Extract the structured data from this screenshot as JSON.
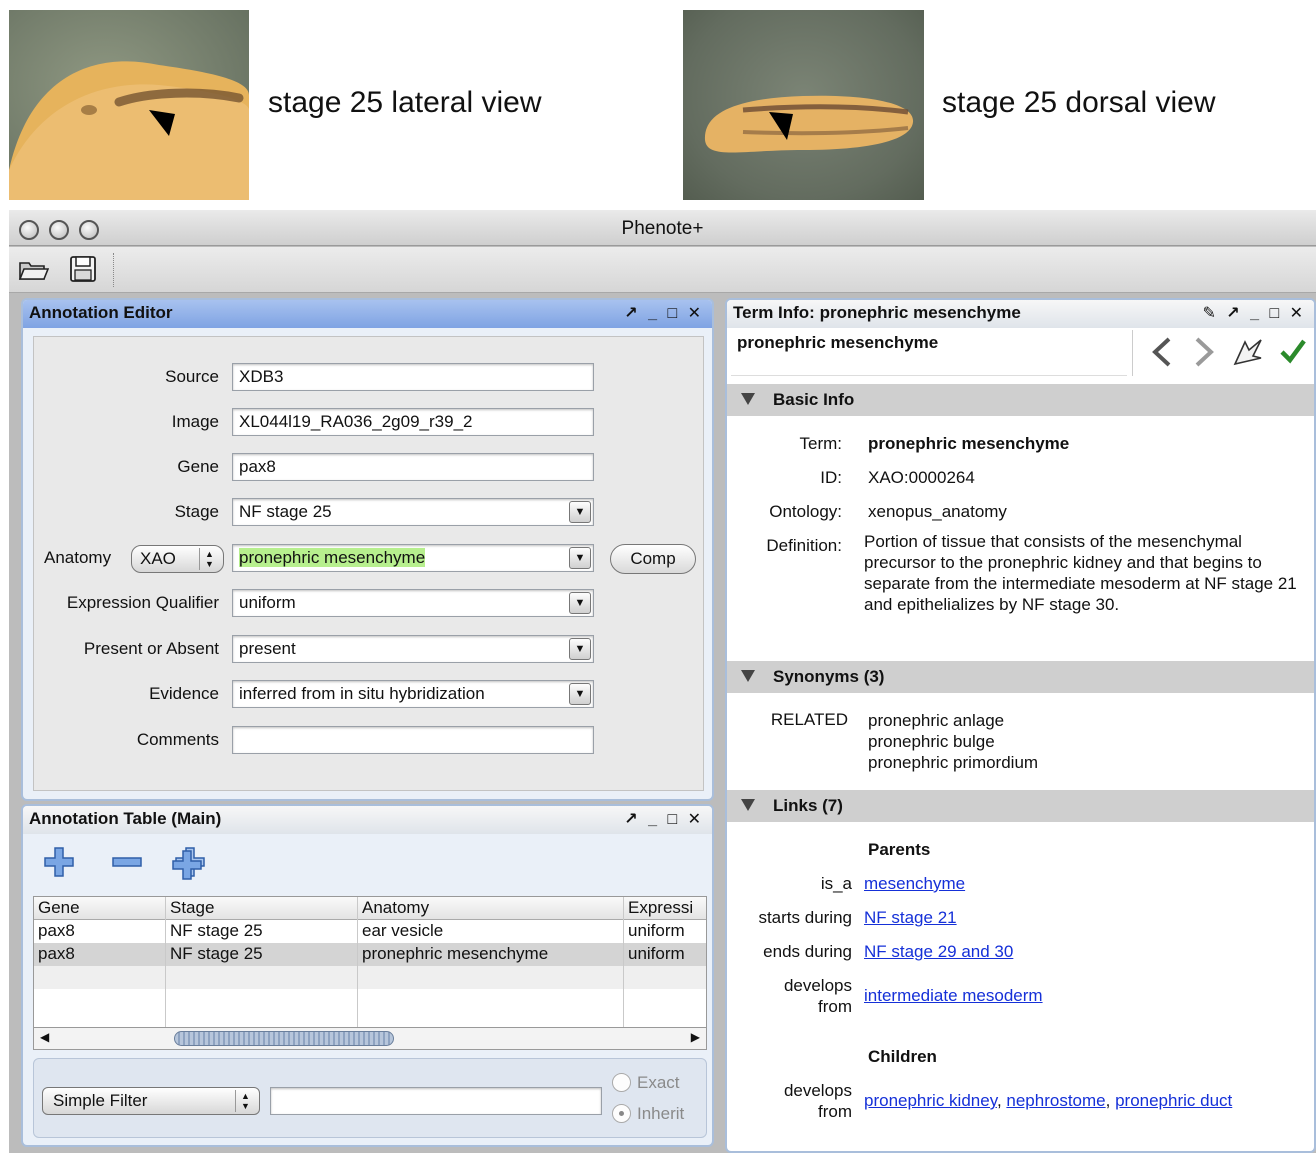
{
  "figure": {
    "left_caption": "stage 25 lateral view",
    "right_caption": "stage 25 dorsal view"
  },
  "window": {
    "title": "Phenote+"
  },
  "editor": {
    "title": "Annotation Editor",
    "controls": "↗ _ □ ✕",
    "fields": {
      "source": {
        "label": "Source",
        "value": "XDB3"
      },
      "image": {
        "label": "Image",
        "value": "XL044l19_RA036_2g09_r39_2"
      },
      "gene": {
        "label": "Gene",
        "value": "pax8"
      },
      "stage": {
        "label": "Stage",
        "value": "NF stage 25"
      },
      "anatomy": {
        "label": "Anatomy",
        "ontology": "XAO",
        "value": "pronephric mesenchyme",
        "comp_label": "Comp"
      },
      "qualifier": {
        "label": "Expression Qualifier",
        "value": "uniform"
      },
      "present": {
        "label": "Present or Absent",
        "value": "present"
      },
      "evidence": {
        "label": "Evidence",
        "value": "inferred from in situ hybridization"
      },
      "comments": {
        "label": "Comments",
        "value": ""
      }
    }
  },
  "table": {
    "title": "Annotation Table (Main)",
    "controls": "↗ _ □ ✕",
    "columns": [
      "Gene",
      "Stage",
      "Anatomy",
      "Expressi"
    ],
    "rows": [
      [
        "pax8",
        "NF stage 25",
        "ear vesicle",
        "uniform"
      ],
      [
        "pax8",
        "NF stage 25",
        "pronephric mesenchyme",
        "uniform"
      ]
    ],
    "filter": {
      "select": "Simple Filter",
      "exact": "Exact",
      "inherit": "Inherit"
    }
  },
  "terminfo": {
    "title": "Term Info: pronephric mesenchyme",
    "controls": "✎ ↗ _ □ ✕",
    "search": "pronephric mesenchyme",
    "basic": {
      "header": "Basic Info",
      "term_key": "Term:",
      "term": "pronephric mesenchyme",
      "id_key": "ID:",
      "id": "XAO:0000264",
      "ont_key": "Ontology:",
      "ontology": "xenopus_anatomy",
      "def_key": "Definition:",
      "definition": "Portion of tissue that consists of the mesenchymal precursor to the pronephric kidney and that begins to separate from the intermediate mesoderm at NF stage 21 and epithelializes by NF stage 30."
    },
    "synonyms": {
      "header": "Synonyms (3)",
      "kind": "RELATED",
      "items": [
        "pronephric anlage",
        "pronephric bulge",
        "pronephric primordium"
      ]
    },
    "links": {
      "header": "Links (7)",
      "parents_label": "Parents",
      "is_a_key": "is_a",
      "is_a": "mesenchyme",
      "starts_key": "starts during",
      "starts": "NF stage 21",
      "ends_key": "ends during",
      "ends": "NF stage 29 and 30",
      "develops_key1": "develops",
      "develops_key2": "from",
      "develops": "intermediate mesoderm",
      "children_label": "Children",
      "child_key1": "develops",
      "child_key2": "from",
      "children": [
        "pronephric kidney",
        "nephrostome",
        "pronephric duct"
      ],
      "child_sep": ", "
    }
  },
  "colors": {
    "panel_header_blue": "#7fa3e3",
    "highlight_green": "#b7ef8e",
    "link_blue": "#1530d8",
    "section_grey": "#cfcfcf"
  }
}
